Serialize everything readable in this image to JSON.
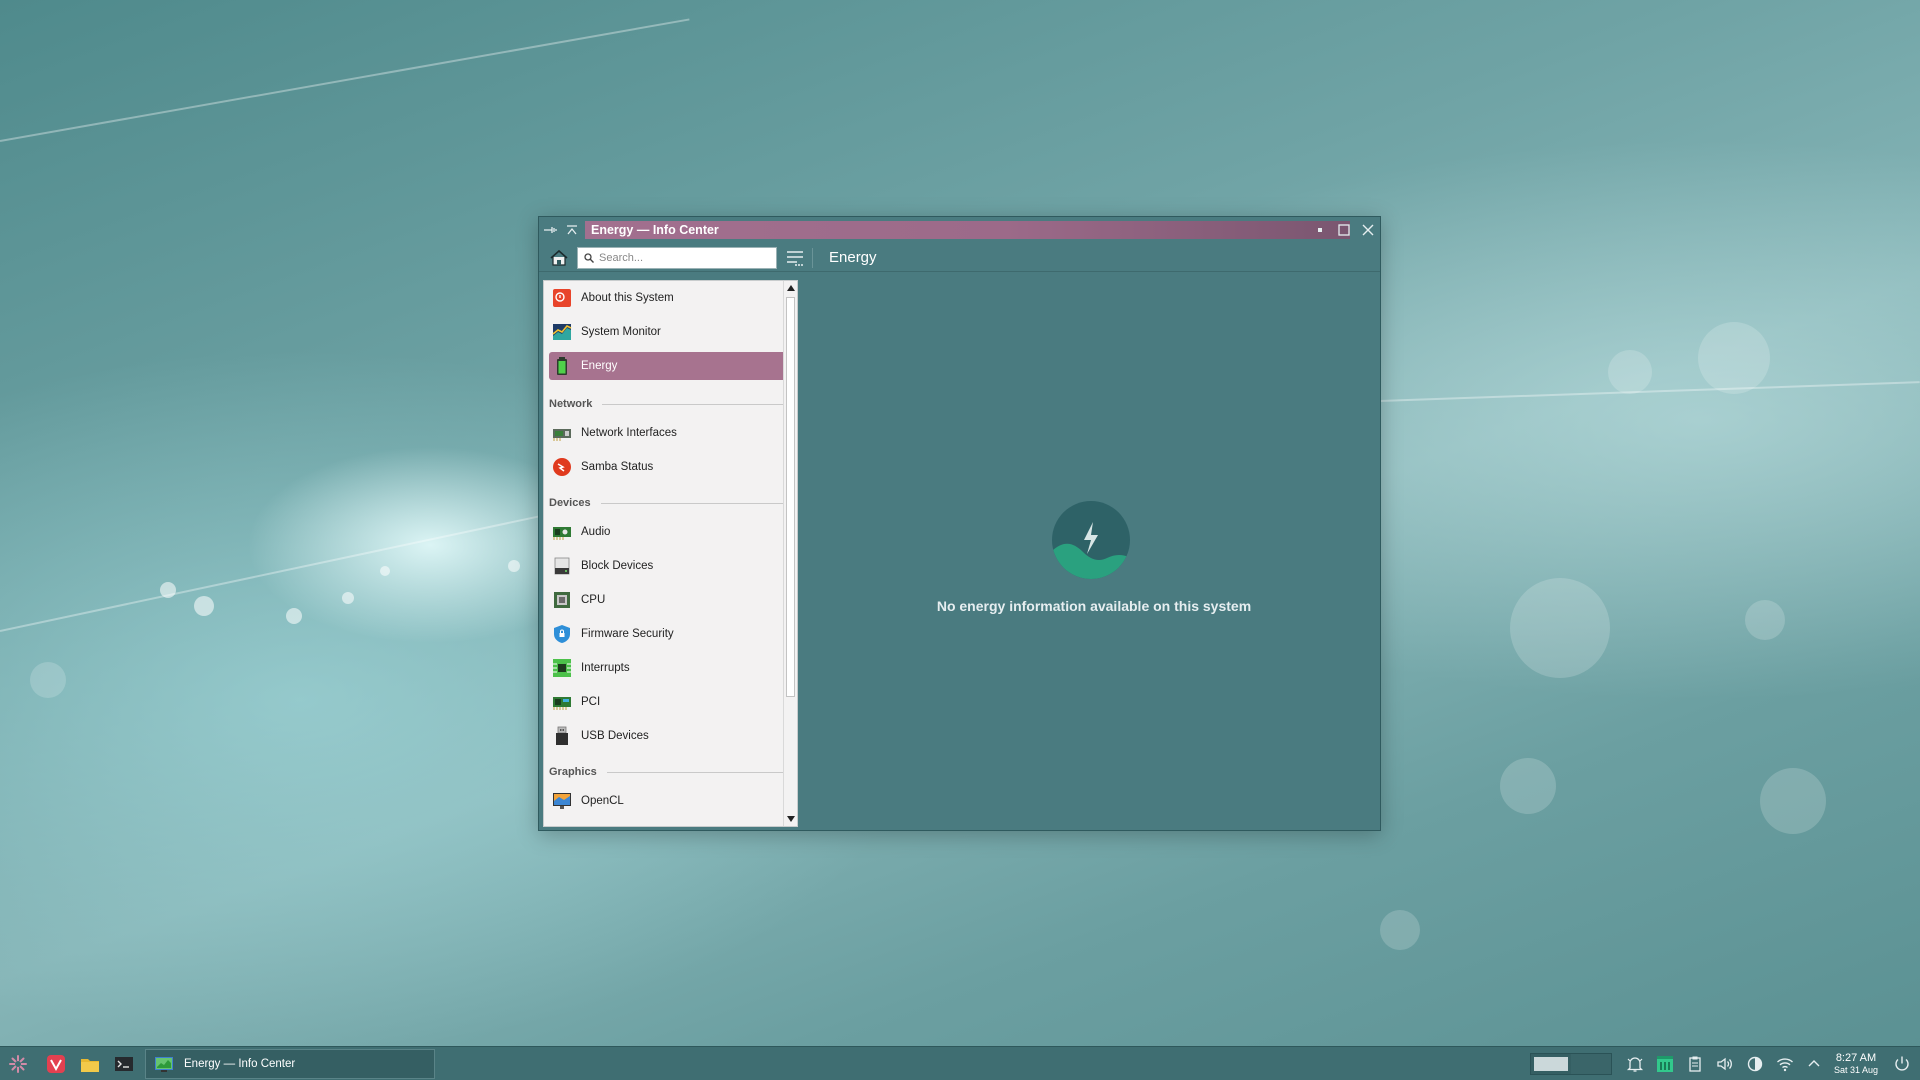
{
  "window": {
    "title": "Energy — Info Center",
    "page_title": "Energy"
  },
  "search": {
    "placeholder": "Search..."
  },
  "sidebar": {
    "items_top": [
      {
        "label": "About this System",
        "icon": "info-icon"
      },
      {
        "label": "System Monitor",
        "icon": "system-monitor-icon"
      },
      {
        "label": "Energy",
        "icon": "battery-icon",
        "selected": true
      }
    ],
    "sections": [
      {
        "title": "Network",
        "items": [
          {
            "label": "Network Interfaces",
            "icon": "network-card-icon"
          },
          {
            "label": "Samba Status",
            "icon": "samba-icon"
          }
        ]
      },
      {
        "title": "Devices",
        "items": [
          {
            "label": "Audio",
            "icon": "audio-card-icon"
          },
          {
            "label": "Block Devices",
            "icon": "drive-icon"
          },
          {
            "label": "CPU",
            "icon": "cpu-icon"
          },
          {
            "label": "Firmware Security",
            "icon": "shield-icon"
          },
          {
            "label": "Interrupts",
            "icon": "interrupts-icon"
          },
          {
            "label": "PCI",
            "icon": "pci-icon"
          },
          {
            "label": "USB Devices",
            "icon": "usb-icon"
          }
        ]
      },
      {
        "title": "Graphics",
        "items": [
          {
            "label": "OpenCL",
            "icon": "opencl-icon"
          }
        ]
      }
    ]
  },
  "content": {
    "message": "No energy information available on this system"
  },
  "taskbar": {
    "task_label": "Energy — Info Center",
    "clock_time": "8:27 AM",
    "clock_date": "Sat 31 Aug"
  },
  "colors": {
    "accent": "#a7738f",
    "window_bg": "#4a7b80",
    "taskbar_bg": "#3f6e72"
  }
}
